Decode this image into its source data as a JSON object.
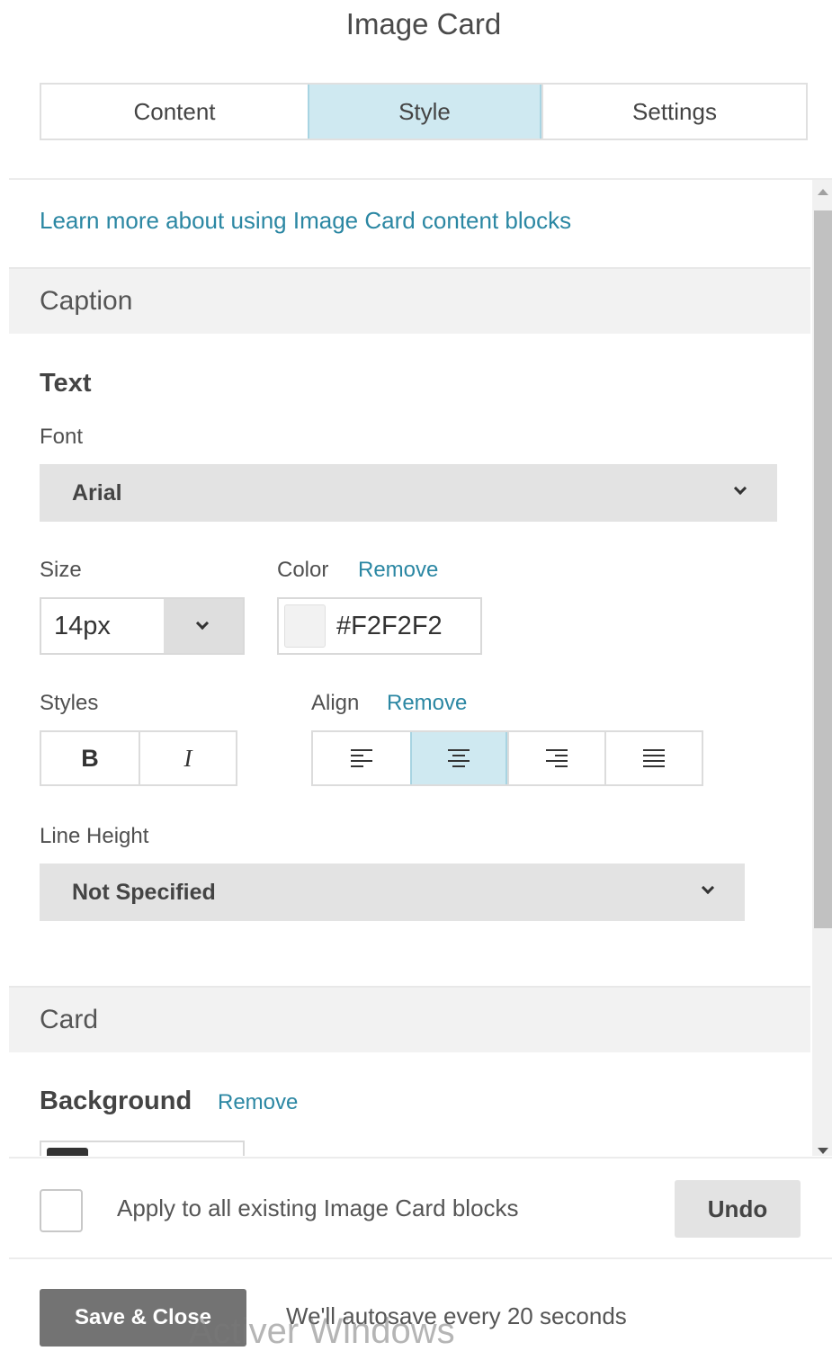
{
  "title": "Image Card",
  "tabs": [
    {
      "label": "Content",
      "active": false
    },
    {
      "label": "Style",
      "active": true
    },
    {
      "label": "Settings",
      "active": false
    }
  ],
  "learn_link": "Learn more about using Image Card content blocks",
  "caption": {
    "header": "Caption",
    "text_heading": "Text",
    "font_label": "Font",
    "font_value": "Arial",
    "size_label": "Size",
    "size_value": "14px",
    "color_label": "Color",
    "color_remove": "Remove",
    "color_value": "#F2F2F2",
    "styles_label": "Styles",
    "bold_label": "B",
    "italic_label": "I",
    "align_label": "Align",
    "align_remove": "Remove",
    "align_active": "center",
    "line_height_label": "Line Height",
    "line_height_value": "Not Specified"
  },
  "card": {
    "header": "Card",
    "background_label": "Background",
    "background_remove": "Remove",
    "background_color": "#333333"
  },
  "apply": {
    "label": "Apply to all existing Image Card blocks",
    "checked": false,
    "undo_label": "Undo"
  },
  "footer": {
    "save_label": "Save & Close",
    "autosave_text": "We'll autosave every 20 seconds",
    "watermark": "Activer Windows"
  },
  "colors": {
    "accent": "#2b87a3",
    "active_tab": "#cfe9f1",
    "swatch_caption": "#F2F2F2"
  }
}
